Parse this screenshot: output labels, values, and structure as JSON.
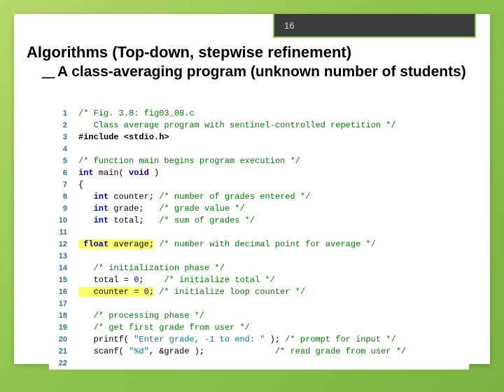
{
  "page_number": "16",
  "title": "Algorithms (Top-down, stepwise refinement)",
  "subtitle_bullet": "⸏",
  "subtitle": "A class-averaging program (unknown number of students)",
  "code": {
    "l1a": "/* Fig. 3.8: fig03_08.c",
    "l2a": "   Class average program with sentinel-controlled repetition */",
    "l3a": "#include ",
    "l3b": "<stdio.h>",
    "l5a": "/* function main begins program execution */",
    "l6a": "int",
    "l6b": " main( ",
    "l6c": "void",
    "l6d": " )",
    "l7a": "{",
    "l8a": "   int",
    "l8b": " counter; ",
    "l8c": "/* number of grades entered */",
    "l9a": "   int",
    "l9b": " grade;   ",
    "l9c": "/* grade value */",
    "l10a": "   int",
    "l10b": " total;   ",
    "l10c": "/* sum of grades */",
    "l12a": "   float average;",
    "l12b": " ",
    "l12c": "/* number with decimal point for average */",
    "l14a": "   /* initialization phase */",
    "l15a": "   total = ",
    "l15b": "0",
    "l15c": ";    ",
    "l15d": "/* initialize total */",
    "l16a": "   counter = 0;",
    "l16b": " ",
    "l16c": "/* initialize loop counter */",
    "l18a": "   /* processing phase */",
    "l19a": "   /* get first grade from user */",
    "l20a": "   printf( ",
    "l20b": "\"Enter grade, -1 to end: \"",
    "l20c": " ); ",
    "l20d": "/* prompt for input */",
    "l21a": "   scanf( ",
    "l21b": "\"%d\"",
    "l21c": ", &grade );              ",
    "l21d": "/* read grade from user */"
  }
}
